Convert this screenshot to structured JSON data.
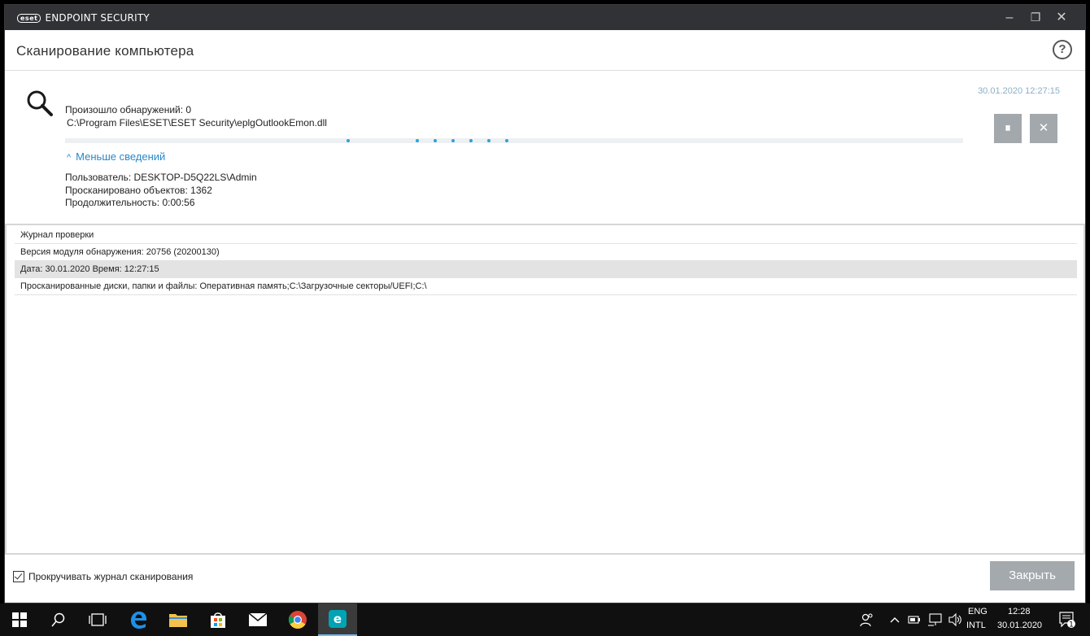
{
  "titlebar": {
    "logo_text": "eset",
    "app_name": "ENDPOINT SECURITY",
    "minimize_glyph": "–",
    "restore_glyph": "❐",
    "close_glyph": "✕"
  },
  "header": {
    "title": "Сканирование компьютера",
    "help_glyph": "?"
  },
  "scan": {
    "detections": "Произошло обнаружений: 0",
    "current_file": "C:\\Program Files\\ESET\\ESET Security\\eplgOutlookEmon.dll",
    "timestamp": "30.01.2020 12:27:15",
    "pause_glyph": "⏸",
    "stop_glyph": "✕",
    "less_details": "Меньше сведений",
    "less_details_chevron": "^",
    "user": "Пользователь: DESKTOP-D5Q22LS\\Admin",
    "scanned_objects": "Просканировано объектов: 1362",
    "duration": "Продолжительность: 0:00:56"
  },
  "log": {
    "rows": [
      "Журнал проверки",
      "Версия модуля обнаружения: 20756 (20200130)",
      "Дата: 30.01.2020  Время: 12:27:15",
      "Просканированные диски, папки и файлы: Оперативная память;C:\\Загрузочные секторы/UEFI;C:\\"
    ]
  },
  "footer": {
    "scroll_log_label": "Прокручивать журнал сканирования",
    "scroll_log_checked": true,
    "close_label": "Закрыть"
  },
  "taskbar": {
    "lang_1": "ENG",
    "lang_2": "INTL",
    "time": "12:28",
    "date": "30.01.2020",
    "notification_count": "1"
  },
  "colors": {
    "accent": "#2d9fdb",
    "link": "#2a88c8",
    "titlebar": "#303236",
    "button": "#a4a9ae"
  }
}
